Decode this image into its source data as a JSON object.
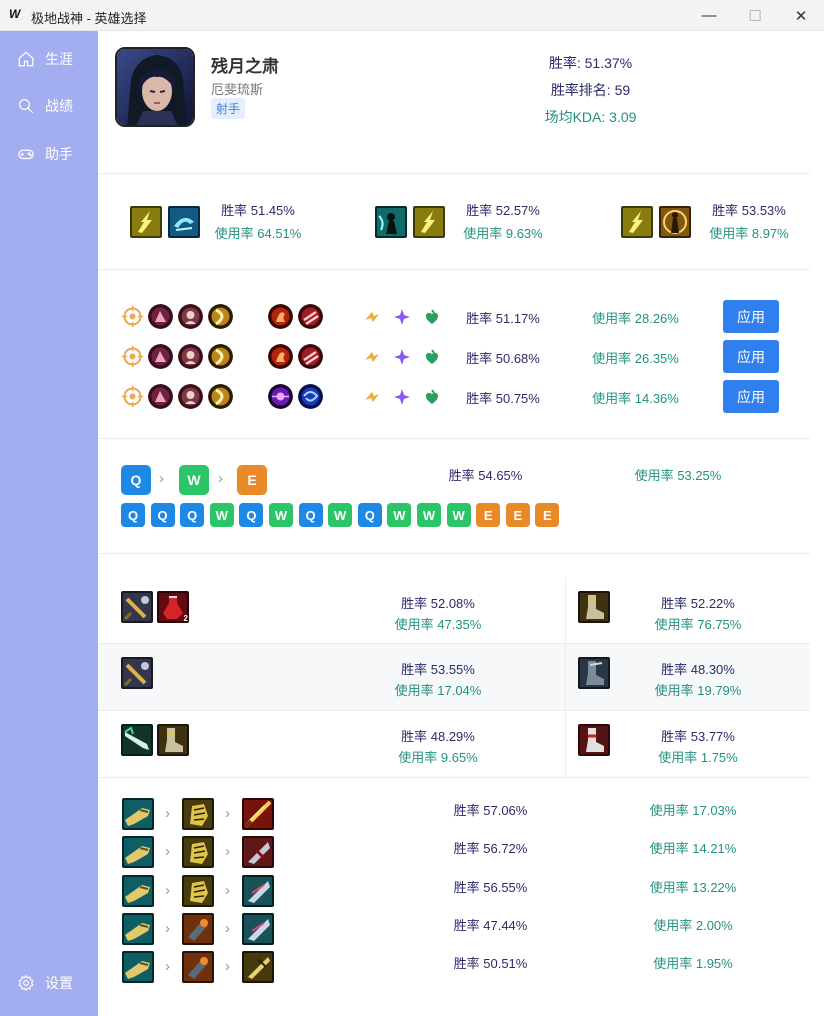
{
  "window": {
    "logo": "W",
    "title": "极地战神 - 英雄选择",
    "min": "—",
    "max": "☐",
    "close": "✕"
  },
  "sidebar": {
    "items": [
      {
        "label": "生涯",
        "icon": "home-icon"
      },
      {
        "label": "战绩",
        "icon": "search-icon"
      },
      {
        "label": "助手",
        "icon": "gamepad-icon"
      }
    ],
    "settings": {
      "label": "设置",
      "icon": "gear-icon"
    }
  },
  "hero": {
    "name": "残月之肃",
    "subname": "厄斐琉斯",
    "tag": "射手",
    "win_rate": "胜率: 51.37%",
    "rank": "胜率排名: 59",
    "kda": "场均KDA: 3.09"
  },
  "summoner_spells": [
    {
      "win": "胜率 51.45%",
      "use": "使用率 64.51%",
      "icons": [
        "flash-spell-icon",
        "ghost-spell-icon"
      ]
    },
    {
      "win": "胜率 52.57%",
      "use": "使用率 9.63%",
      "icons": [
        "cleanse-spell-icon",
        "flash-spell-icon"
      ]
    },
    {
      "win": "胜率 53.53%",
      "use": "使用率 8.97%",
      "icons": [
        "flash-spell-icon",
        "barrier-spell-icon"
      ]
    }
  ],
  "rune_pages": [
    {
      "win": "胜率 51.17%",
      "use": "使用率 28.26%",
      "apply": "应用"
    },
    {
      "win": "胜率 50.68%",
      "use": "使用率 26.35%",
      "apply": "应用"
    },
    {
      "win": "胜率 50.75%",
      "use": "使用率 14.36%",
      "apply": "应用"
    }
  ],
  "skills": {
    "order": [
      "Q",
      "W",
      "E"
    ],
    "sequence": [
      "Q",
      "Q",
      "Q",
      "W",
      "Q",
      "W",
      "Q",
      "W",
      "Q",
      "W",
      "W",
      "W",
      "E",
      "E",
      "E"
    ],
    "win": "胜率 54.65%",
    "use": "使用率 53.25%"
  },
  "starter_items": [
    {
      "win": "胜率 52.08%",
      "use": "使用率 47.35%",
      "badge": "2"
    },
    {
      "win": "胜率 53.55%",
      "use": "使用率 17.04%"
    },
    {
      "win": "胜率 48.29%",
      "use": "使用率 9.65%"
    }
  ],
  "boots": [
    {
      "win": "胜率 52.22%",
      "use": "使用率 76.75%"
    },
    {
      "win": "胜率 48.30%",
      "use": "使用率 19.79%"
    },
    {
      "win": "胜率 53.77%",
      "use": "使用率 1.75%"
    }
  ],
  "core_builds": [
    {
      "win": "胜率 57.06%",
      "use": "使用率 17.03%"
    },
    {
      "win": "胜率 56.72%",
      "use": "使用率 14.21%"
    },
    {
      "win": "胜率 56.55%",
      "use": "使用率 13.22%"
    },
    {
      "win": "胜率 47.44%",
      "use": "使用率 2.00%"
    },
    {
      "win": "胜率 50.51%",
      "use": "使用率 1.95%"
    }
  ]
}
